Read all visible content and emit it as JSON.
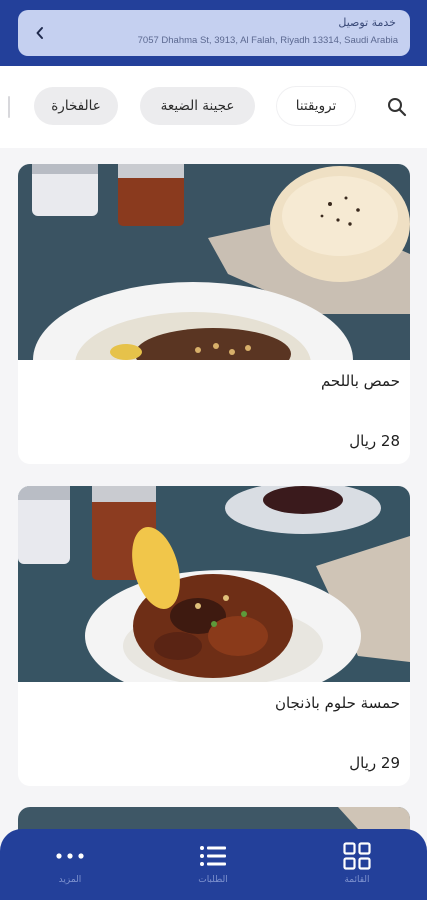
{
  "header": {
    "title": "خدمة توصيل",
    "address": "7057 Dhahma St, 3913, Al Falah, Riyadh 13314, Saudi Arabia",
    "chevron_icon": "chevron-left-icon"
  },
  "categories": {
    "search_icon": "search-icon",
    "items": [
      {
        "label": "عالفخارة",
        "active": false
      },
      {
        "label": "عجينة الضيعة",
        "active": false
      },
      {
        "label": "ترويقتنا",
        "active": true
      }
    ]
  },
  "products": [
    {
      "name": "حمص باللحم",
      "price": "28 ريال"
    },
    {
      "name": "حمسة حلوم باذنجان",
      "price": "29 ريال"
    },
    {
      "name": "",
      "price": ""
    }
  ],
  "bottom_nav": [
    {
      "label": "المزيد",
      "icon": "more-dots-icon"
    },
    {
      "label": "الطلبات",
      "icon": "list-icon"
    },
    {
      "label": "القائمة",
      "icon": "grid-icon"
    }
  ],
  "colors": {
    "primary": "#23409a",
    "pill": "#c5d0f0",
    "background": "#f5f5f7"
  }
}
